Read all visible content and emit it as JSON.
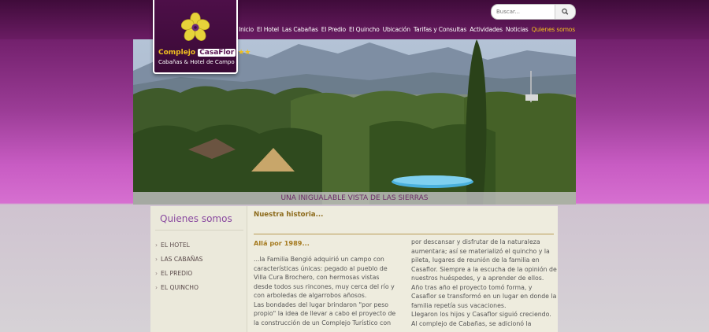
{
  "logo": {
    "prefix": "Complejo ",
    "brand": "CasaFlor",
    "stars": "★★",
    "subtitle": "Cabañas & Hotel de Campo"
  },
  "search": {
    "placeholder": "Buscar..."
  },
  "nav": {
    "items": [
      "Inicio",
      "El Hotel",
      "Las Cabañas",
      "El Predio",
      "El Quincho",
      "Ubicación",
      "Tarifas y Consultas",
      "Actividades",
      "Noticias",
      "Quienes somos"
    ],
    "active": "Quienes somos"
  },
  "hero": {
    "caption": "UNA INIGUALABLE VISTA DE LAS SIERRAS"
  },
  "sidebar": {
    "title": "Quienes somos",
    "items": [
      "EL HOTEL",
      "LAS CABAÑAS",
      "EL PREDIO",
      "EL QUINCHO"
    ]
  },
  "main": {
    "title": "Nuestra historia...",
    "subtitle": "Allá por 1989...",
    "col1": "...la Familia Bengió adquirió un campo con características únicas: pegado al pueblo de Villa Cura Brochero, con hermosas vistas desde todos sus rincones, muy cerca del río y con arboledas de algarrobos añosos.\nLas bondades del lugar brindaron \"por peso propio\" la idea de llevar a cabo el proyecto de la construcción de un Complejo Turístico con",
    "col2": "por descansar y disfrutar de la naturaleza aumentara; así se materializó el quincho y la pileta, lugares de reunión de la familia en Casaflor. Siempre a la escucha de la opinión de nuestros huéspedes, y a aprender de ellos. Año tras año el proyecto tomó forma, y Casaflor se transformó en un lugar en donde la familia repetía sus vacaciones.\nLlegaron los hijos y Casaflor siguió creciendo. Al complejo de Cabañas, se adicionó la"
  },
  "colors": {
    "accent": "#5a1553",
    "gold": "#f3c01c",
    "purple": "#8a4aa0"
  }
}
